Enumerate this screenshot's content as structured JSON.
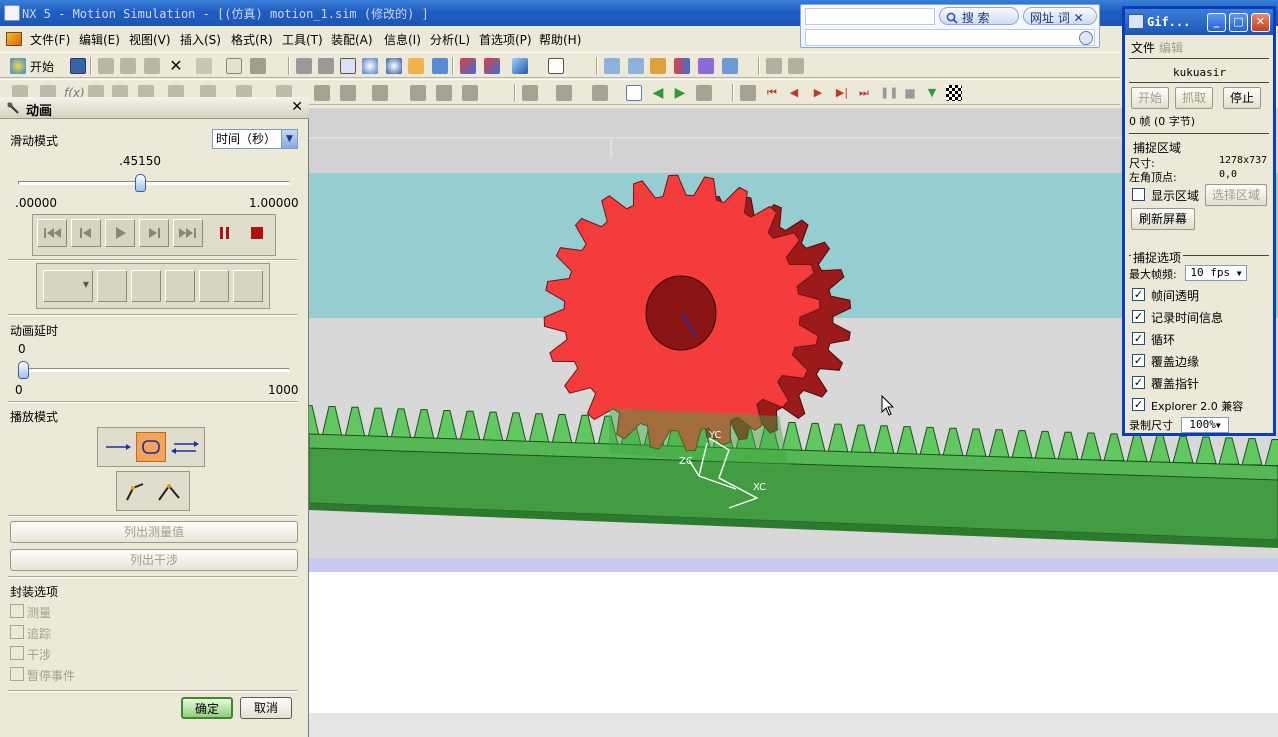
{
  "window": {
    "title": "NX 5 - Motion Simulation - [(仿真) motion_1.sim  (修改的) ]"
  },
  "search_bar": {
    "search_label": "搜 索",
    "url_label": "网址 词"
  },
  "menu": {
    "items": [
      "文件(F)",
      "编辑(E)",
      "视图(V)",
      "插入(S)",
      "格式(R)",
      "工具(T)",
      "装配(A)",
      "信息(I)",
      "分析(L)",
      "首选项(P)",
      "帮助(H)"
    ]
  },
  "toolbar": {
    "start_label": "开始"
  },
  "dialog": {
    "title": "动画",
    "slide_mode_label": "滑动模式",
    "slide_mode_value": "时间（秒）",
    "time_slider": {
      "value_label": ".45150",
      "min_label": ".00000",
      "max_label": "1.00000",
      "fraction": 0.4515
    },
    "delay_label": "动画延时",
    "delay_slider": {
      "value_label": "0",
      "min_label": "0",
      "max_label": "1000",
      "fraction": 0
    },
    "play_mode_label": "播放模式",
    "list_measurements": "列出测量值",
    "list_interference": "列出干涉",
    "package_options_label": "封装选项",
    "package_options": [
      "测量",
      "追踪",
      "干涉",
      "暂停事件"
    ],
    "ok_label": "确定",
    "cancel_label": "取消"
  },
  "gif_recorder": {
    "title": "Gif...",
    "menu": [
      "文件",
      "编辑"
    ],
    "user": "kukuasir",
    "start_label": "开始",
    "capture_label": "抓取",
    "stop_label": "停止",
    "frames_info": "0 帧 (0 字节)",
    "capture_area_heading": "捕捉区域",
    "size_label": "尺寸:",
    "size_value": "1278x737",
    "topleft_label": "左角顶点:",
    "topleft_value": "0,0",
    "show_area_label": "显示区域",
    "select_area_label": "选择区域",
    "refresh_label": "刷新屏幕",
    "capture_options_heading": "捕捉选项",
    "max_fps_label": "最大帧频:",
    "max_fps_value": "10 fps",
    "options": [
      "帧间透明",
      "记录时间信息",
      "循环",
      "覆盖边缘",
      "覆盖指针",
      "Explorer 2.0 兼容"
    ],
    "record_size_label": "录制尺寸",
    "record_size_value": "100%"
  },
  "viewport": {
    "axis_labels": {
      "yc": "YC",
      "zc": "ZC",
      "xc": "XC"
    },
    "gear_color": "#f43c3c",
    "rack_color": "#5fc75f"
  }
}
